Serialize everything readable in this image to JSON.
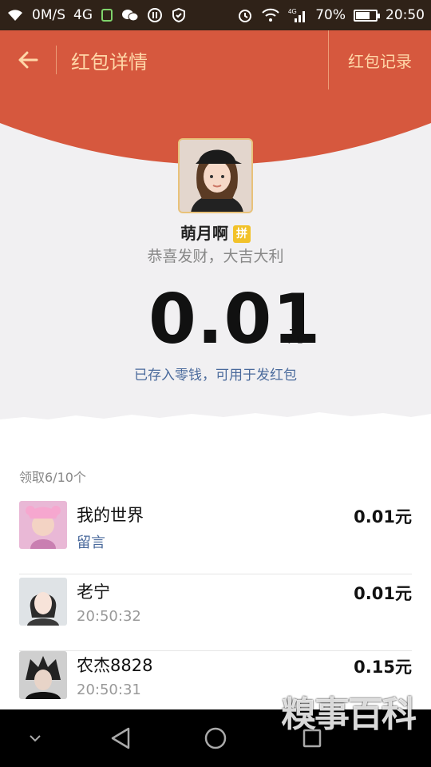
{
  "status_bar": {
    "speed": "0M/S",
    "network": "4G",
    "signal_label": "4G",
    "battery": "70%",
    "battery_level": 0.7,
    "time": "20:50"
  },
  "header": {
    "title": "红包详情",
    "records_label": "红包记录"
  },
  "packet": {
    "sender_name": "萌月啊",
    "sender_badge": "拼",
    "blessing": "恭喜发财，大吉大利",
    "amount": "0.01",
    "unit": "元",
    "saved_note": "已存入零钱，可用于发红包"
  },
  "list": {
    "count_label": "领取6/10个",
    "rows": [
      {
        "name": "我的世界",
        "sub": "留言",
        "amount": "0.01元"
      },
      {
        "name": "老宁",
        "sub": "20:50:32",
        "amount": "0.01元"
      },
      {
        "name": "农杰8828",
        "sub": "20:50:31",
        "amount": "0.15元"
      }
    ]
  },
  "watermark": "糗事百科",
  "colors": {
    "header_red": "#d6583e",
    "accent_gold": "#ffd7a8",
    "link_blue": "#4a6a9c"
  }
}
